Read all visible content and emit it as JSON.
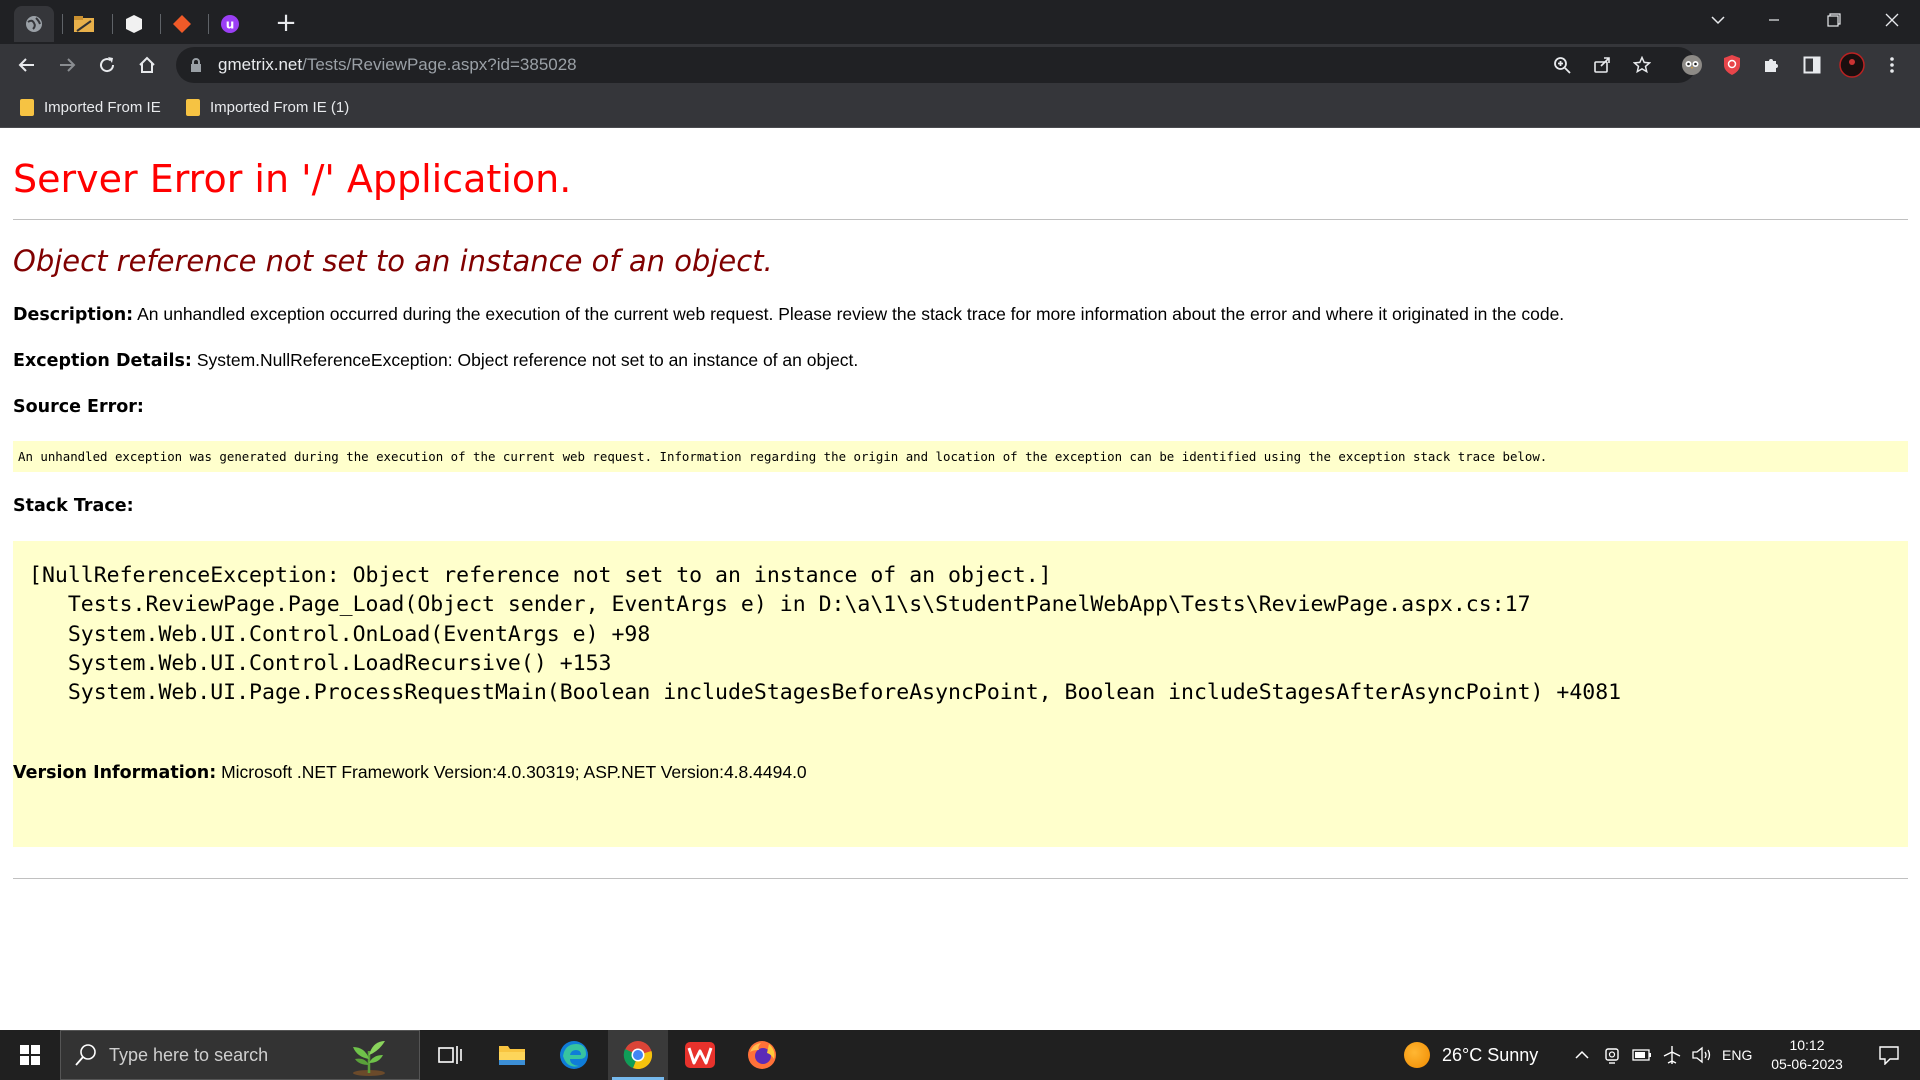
{
  "browser": {
    "url_domain": "gmetrix.net",
    "url_path": "/Tests/ReviewPage.aspx?id=385028",
    "bookmarks": [
      {
        "label": "Imported From IE"
      },
      {
        "label": "Imported From IE (1)"
      }
    ],
    "tab_icons": [
      "globe-icon",
      "folder-tab-icon",
      "cube-icon",
      "diamond-icon",
      "u-badge-icon"
    ],
    "new_tab_label": "+"
  },
  "page": {
    "title": "Server Error in '/' Application.",
    "error_message": "Object reference not set to an instance of an object.",
    "description": {
      "label": "Description:",
      "text": "An unhandled exception occurred during the execution of the current web request. Please review the stack trace for more information about the error and where it originated in the code."
    },
    "exception_details": {
      "label": "Exception Details:",
      "text": "System.NullReferenceException: Object reference not set to an instance of an object."
    },
    "source_error": {
      "label": "Source Error:",
      "text": "An unhandled exception was generated during the execution of the current web request. Information regarding the origin and location of the exception can be identified using the exception stack trace below."
    },
    "stack_trace": {
      "label": "Stack Trace:",
      "lines": [
        "[NullReferenceException: Object reference not set to an instance of an object.]",
        "   Tests.ReviewPage.Page_Load(Object sender, EventArgs e) in D:\\a\\1\\s\\StudentPanelWebApp\\Tests\\ReviewPage.aspx.cs:17",
        "   System.Web.UI.Control.OnLoad(EventArgs e) +98",
        "   System.Web.UI.Control.LoadRecursive() +153",
        "   System.Web.UI.Page.ProcessRequestMain(Boolean includeStagesBeforeAsyncPoint, Boolean includeStagesAfterAsyncPoint) +4081"
      ]
    },
    "version_info": {
      "label": "Version Information:",
      "text": "Microsoft .NET Framework Version:4.0.30319; ASP.NET Version:4.8.4494.0"
    }
  },
  "taskbar": {
    "search_placeholder": "Type here to search",
    "weather": "26°C  Sunny",
    "language": "ENG",
    "time": "10:12",
    "date": "05-06-2023",
    "apps": [
      "task-view-icon",
      "file-explorer-icon",
      "edge-icon",
      "chrome-icon",
      "wps-icon",
      "firefox-icon"
    ]
  },
  "colors": {
    "title_red": "#ff0000",
    "message_maroon": "#800000",
    "code_background": "#ffffcc",
    "chrome_dark": "#202124",
    "chrome_toolbar": "#35363a"
  }
}
